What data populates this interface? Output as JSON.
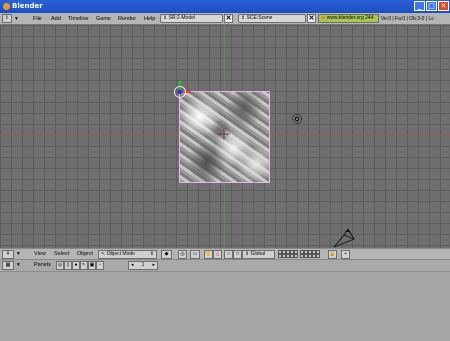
{
  "window": {
    "title": "Blender",
    "buttons": {
      "minimize": "_",
      "maximize": "□",
      "close": "✕"
    }
  },
  "menubar": {
    "menus": [
      "File",
      "Add",
      "Timeline",
      "Game",
      "Render",
      "Help"
    ],
    "screen": "SR:2-Model",
    "scene": "SCE:Scene",
    "url": "www.blender.org 244",
    "stats": "Ve:0 | Fa:0 | Ob:3-0 | Lc"
  },
  "viewport_header": {
    "menus": [
      "View",
      "Select",
      "Object"
    ],
    "mode": "Object Mode",
    "pivot": "Global"
  },
  "buttons_header": {
    "label": "Panels",
    "frame": "1"
  },
  "colors": {
    "viewport_bg": "#6f6f6f",
    "header_bg": "#b5b5b5",
    "titlebar": "#1c4fc2",
    "url_green": "#a7c84f"
  }
}
